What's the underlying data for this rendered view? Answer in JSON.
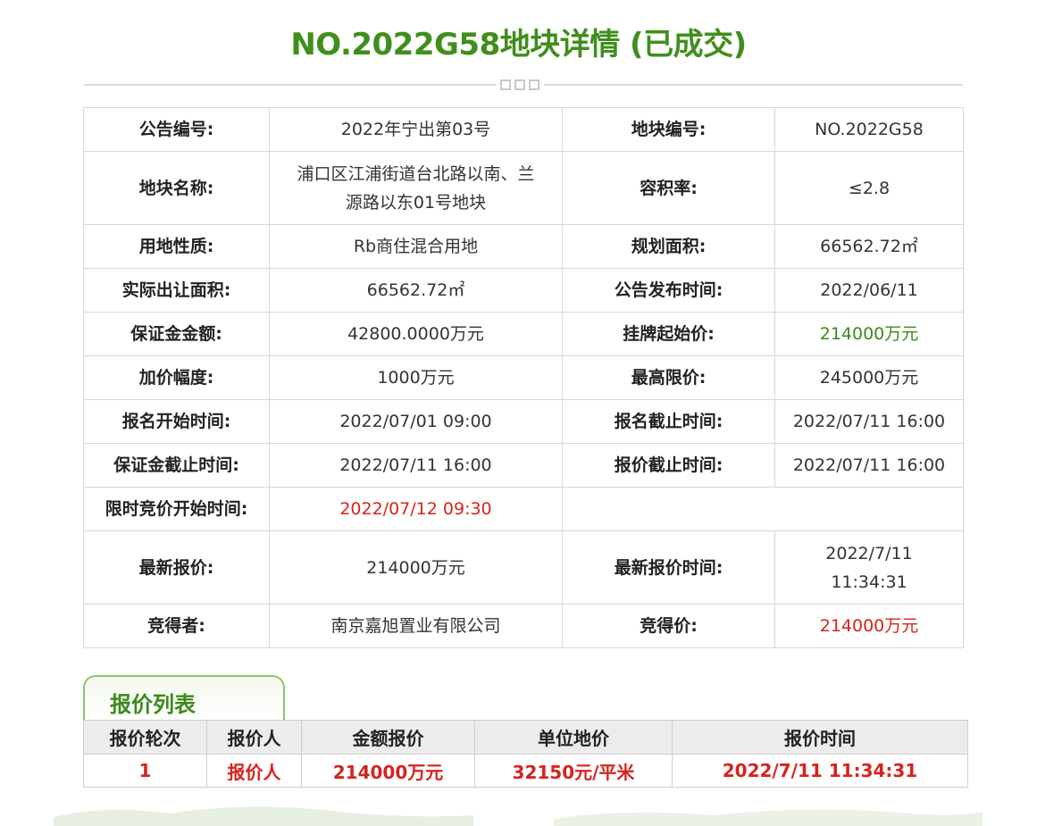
{
  "title": "NO.2022G58地块详情 (已成交)",
  "details": {
    "rows": [
      {
        "l1": "公告编号:",
        "v1": "2022年宁出第03号",
        "l2": "地块编号:",
        "v2": "NO.2022G58"
      },
      {
        "l1": "地块名称:",
        "v1a": "浦口区江浦街道台北路以南、兰",
        "v1b": "源路以东01号地块",
        "l2": "容积率:",
        "v2": "≤2.8"
      },
      {
        "l1": "用地性质:",
        "v1": "Rb商住混合用地",
        "l2": "规划面积:",
        "v2": "66562.72㎡"
      },
      {
        "l1": "实际出让面积:",
        "v1": "66562.72㎡",
        "l2": "公告发布时间:",
        "v2": "2022/06/11"
      },
      {
        "l1": "保证金金额:",
        "v1": "42800.0000万元",
        "l2": "挂牌起始价:",
        "v2": "214000万元"
      },
      {
        "l1": "加价幅度:",
        "v1": "1000万元",
        "l2": "最高限价:",
        "v2": "245000万元"
      },
      {
        "l1": "报名开始时间:",
        "v1": "2022/07/01 09:00",
        "l2": "报名截止时间:",
        "v2": "2022/07/11 16:00"
      },
      {
        "l1": "保证金截止时间:",
        "v1": "2022/07/11 16:00",
        "l2": "报价截止时间:",
        "v2": "2022/07/11 16:00"
      },
      {
        "l1": "限时竞价开始时间:",
        "v1": "2022/07/12 09:30"
      },
      {
        "l1": "最新报价:",
        "v1": "214000万元",
        "l2": "最新报价时间:",
        "v2a": "2022/7/11",
        "v2b": "11:34:31"
      },
      {
        "l1": "竞得者:",
        "v1": "南京嘉旭置业有限公司",
        "l2": "竞得价:",
        "v2": "214000万元"
      }
    ]
  },
  "bids": {
    "tab_label": "报价列表",
    "headers": [
      "报价轮次",
      "报价人",
      "金额报价",
      "单位地价",
      "报价时间"
    ],
    "rows": [
      [
        "1",
        "报价人",
        "214000万元",
        "32150元/平米",
        "2022/7/11 11:34:31"
      ]
    ]
  },
  "colors": {
    "title_green": "#3f8f1b",
    "highlight_green": "#3b8a1c",
    "highlight_red": "#d6231d"
  }
}
